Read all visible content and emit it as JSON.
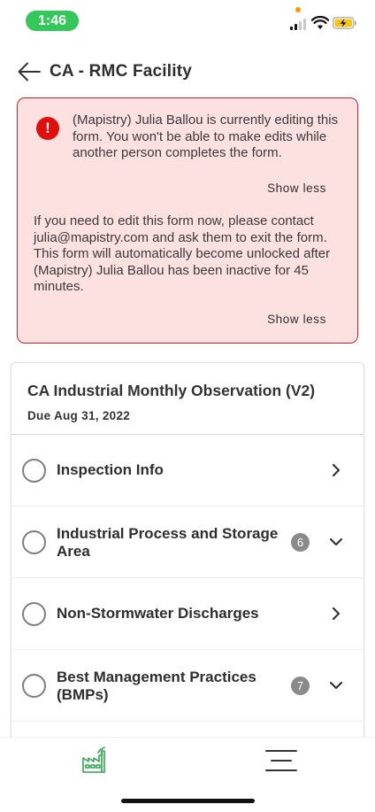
{
  "status_bar": {
    "time": "1:46"
  },
  "header": {
    "title": "CA - RMC Facility",
    "back_icon": "arrow-left-icon"
  },
  "alert": {
    "icon": "exclamation-icon",
    "icon_glyph": "!",
    "message_1": "(Mapistry) Julia Ballou is currently editing this form. You won't be able to make edits while another person completes the form.",
    "show_less_1": "Show less",
    "message_2": "If you need to edit this form now, please contact julia@mapistry.com and ask them to exit the form. This form will automatically become unlocked after (Mapistry) Julia Ballou has been inactive for 45 minutes.",
    "show_less_2": "Show less",
    "colors": {
      "background": "#fde0e0",
      "border": "#c8252c",
      "icon": "#e10e0e"
    }
  },
  "form": {
    "title": "CA Industrial Monthly Observation (V2)",
    "due": "Due Aug 31, 2022",
    "sections": [
      {
        "label": "Inspection Info",
        "badge": "",
        "chevron": "chevron-right-icon"
      },
      {
        "label": "Industrial Process and Storage Area",
        "badge": "6",
        "chevron": "chevron-down-icon"
      },
      {
        "label": "Non-Stormwater Discharges",
        "badge": "",
        "chevron": "chevron-right-icon"
      },
      {
        "label": "Best Management Practices (BMPs)",
        "badge": "7",
        "chevron": "chevron-down-icon"
      }
    ]
  },
  "bottom_nav": {
    "items": [
      {
        "icon": "factory-icon",
        "active": true,
        "color": "#2fa84f"
      },
      {
        "icon": "menu-icon",
        "active": false,
        "color": "#333333"
      }
    ]
  }
}
